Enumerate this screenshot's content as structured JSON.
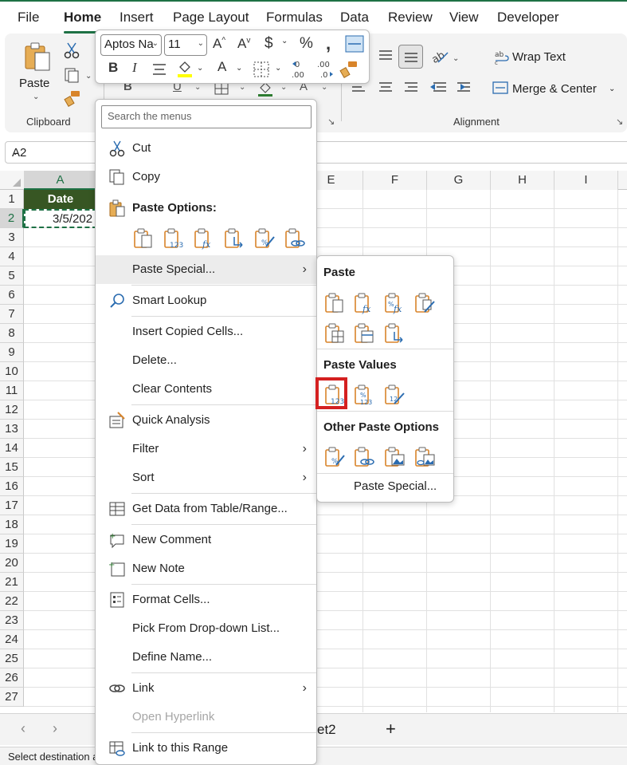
{
  "ribbon_tabs": [
    "File",
    "Home",
    "Insert",
    "Page Layout",
    "Formulas",
    "Data",
    "Review",
    "View",
    "Developer"
  ],
  "active_tab": "Home",
  "clipboard": {
    "paste_label": "Paste",
    "group_label": "Clipboard"
  },
  "alignment": {
    "wrap_text": "Wrap Text",
    "merge_center": "Merge & Center",
    "group_label": "Alignment"
  },
  "mini_toolbar": {
    "font_name": "Aptos Na",
    "font_size": "11"
  },
  "name_box": "A2",
  "columns": [
    "A",
    "E",
    "F",
    "G",
    "H",
    "I"
  ],
  "rows": [
    "1",
    "2",
    "3",
    "4",
    "5",
    "6",
    "7",
    "8",
    "9",
    "10",
    "11",
    "12",
    "13",
    "14",
    "15",
    "16",
    "17",
    "18",
    "19",
    "20",
    "21",
    "22",
    "23",
    "24",
    "25",
    "26",
    "27"
  ],
  "cells": {
    "A1": "Date",
    "A2": "3/5/202"
  },
  "sheet_tab_fragment": "et2",
  "add_sheet": "+",
  "status_text": "Select destination a",
  "context_menu": {
    "search_placeholder": "Search the menus",
    "cut": "Cut",
    "copy": "Copy",
    "paste_options": "Paste Options:",
    "paste_special": "Paste Special...",
    "smart_lookup": "Smart Lookup",
    "insert_copied": "Insert Copied Cells...",
    "delete": "Delete...",
    "clear_contents": "Clear Contents",
    "quick_analysis": "Quick Analysis",
    "filter": "Filter",
    "sort": "Sort",
    "get_data": "Get Data from Table/Range...",
    "new_comment": "New Comment",
    "new_note": "New Note",
    "format_cells": "Format Cells...",
    "pick_dropdown": "Pick From Drop-down List...",
    "define_name": "Define Name...",
    "link": "Link",
    "open_hyperlink": "Open Hyperlink",
    "link_range": "Link to this Range"
  },
  "submenu": {
    "paste_title": "Paste",
    "paste_values_title": "Paste Values",
    "other_title": "Other Paste Options",
    "paste_special": "Paste Special..."
  },
  "colors": {
    "accent": "#1e7145",
    "header_fill": "#375623",
    "icon_orange": "#d8842a",
    "icon_blue": "#2b6cb0",
    "highlight": "#d42020"
  }
}
